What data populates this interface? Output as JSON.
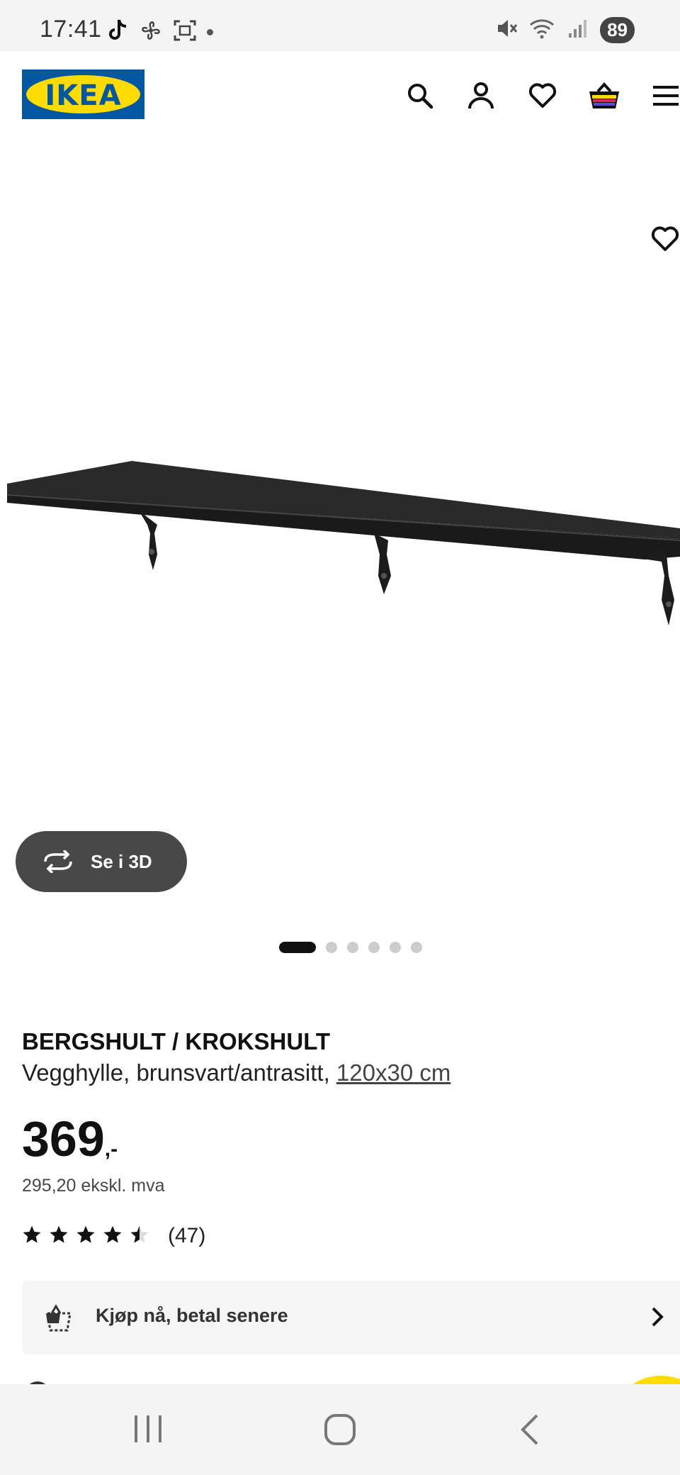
{
  "status_bar": {
    "time": "17:41",
    "battery": "89",
    "left_icons": [
      "tiktok-icon",
      "fan-icon",
      "screenshot-icon",
      "dot-icon"
    ],
    "right_icons": [
      "mute-icon",
      "wifi-icon",
      "signal-icon"
    ]
  },
  "header": {
    "logo_text": "IKEA",
    "icons": [
      "search-icon",
      "account-icon",
      "wishlist-icon",
      "basket-icon",
      "menu-icon"
    ],
    "colors": {
      "logo_blue": "#0058a3",
      "logo_yellow": "#ffdb00"
    }
  },
  "gallery": {
    "view_3d_label": "Se i 3D",
    "total_images": 6,
    "active_index": 0
  },
  "product": {
    "title": "BERGSHULT / KROKSHULT",
    "description": "Vegghylle, brunsvart/antrasitt, ",
    "size_link": "120x30 cm",
    "price": "369",
    "price_suffix": ",-",
    "price_ex_vat": "295,20 ekskl. mva",
    "rating": 4.5,
    "rating_max": 5,
    "review_count": "(47)"
  },
  "payment": {
    "label": "Kjøp nå, betal senere"
  },
  "navigation": [
    "recent-apps-icon",
    "home-icon",
    "back-icon"
  ]
}
